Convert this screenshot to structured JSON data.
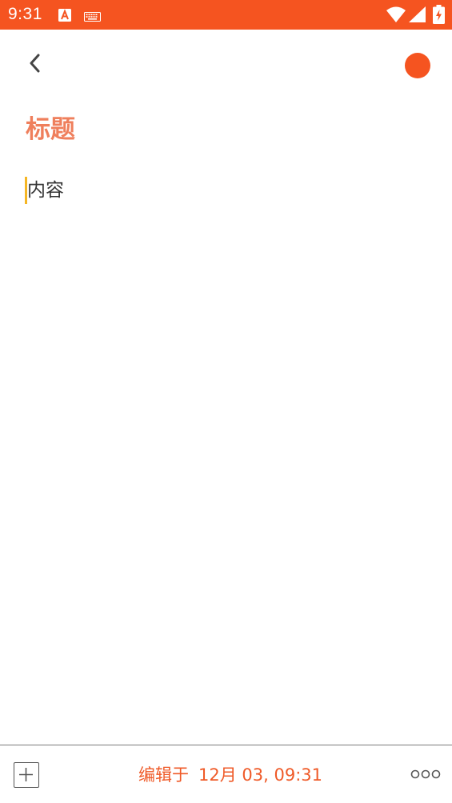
{
  "status_bar": {
    "time": "9:31",
    "background_color": "#f55420",
    "icons": [
      "a-notification-icon",
      "keyboard-icon",
      "wifi-icon",
      "cell-signal-icon",
      "battery-charging-icon"
    ]
  },
  "toolbar": {
    "back_icon": "chevron-left-icon",
    "color_indicator": "#f55420"
  },
  "note": {
    "title": "标题",
    "body": "内容"
  },
  "bottom_bar": {
    "add_icon": "plus-square-icon",
    "edited_label": "编辑于",
    "edited_time": "12月 03, 09:31",
    "more_icon": "more-dots-icon"
  },
  "colors": {
    "accent": "#f55420",
    "title": "#ef7f5c",
    "cursor": "#f5b624"
  }
}
